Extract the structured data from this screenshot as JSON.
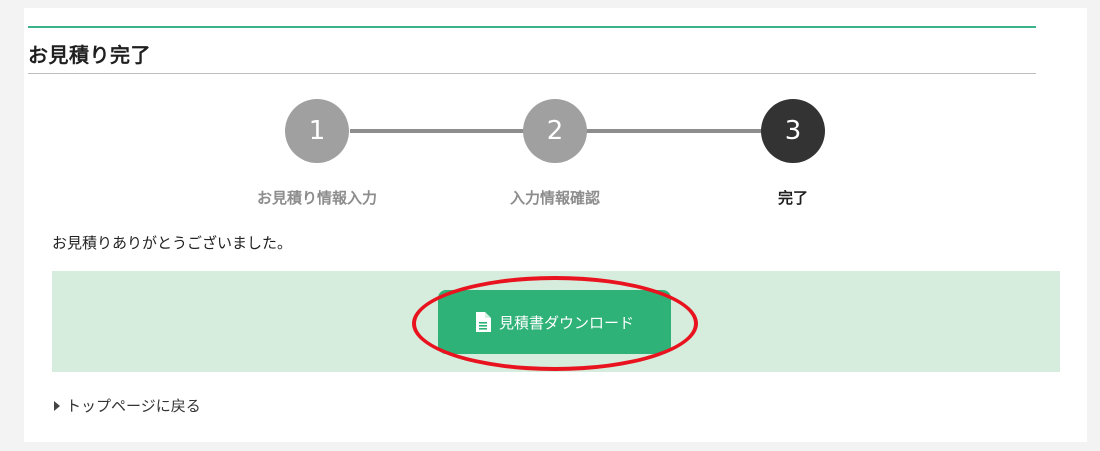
{
  "page": {
    "title": "お見積り完了"
  },
  "steps": [
    {
      "number": "1",
      "label": "お見積り情報入力",
      "state": "done"
    },
    {
      "number": "2",
      "label": "入力情報確認",
      "state": "done"
    },
    {
      "number": "3",
      "label": "完了",
      "state": "active"
    }
  ],
  "message": "お見積りありがとうございました。",
  "download": {
    "label": "見積書ダウンロード",
    "icon": "document-icon"
  },
  "back_link": {
    "label": "トップページに戻る",
    "icon": "caret-right-icon"
  },
  "colors": {
    "accent": "#3bb38a",
    "button": "#2fb278",
    "panel": "#d6ecdc",
    "highlight": "#e8131e",
    "step_inactive": "#a0a0a0",
    "step_active": "#333333"
  }
}
